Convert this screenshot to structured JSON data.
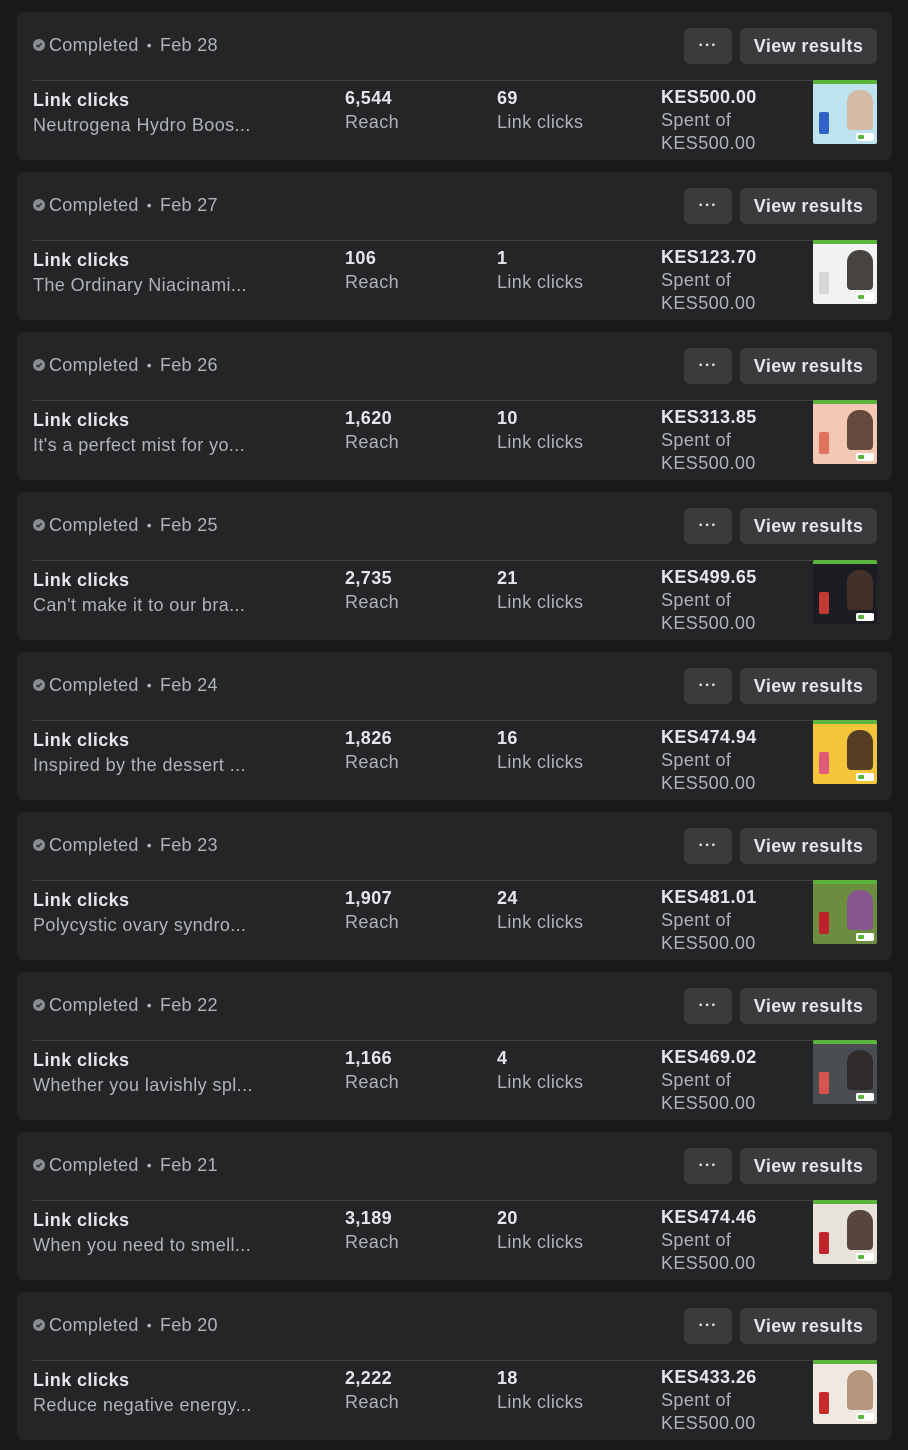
{
  "campaigns": [
    {
      "status": "Completed",
      "date": "Feb 28",
      "more_label": "···",
      "view_label": "View results",
      "objective": "Link clicks",
      "ad_text": "Neutrogena Hydro Boos...",
      "reach_value": "6,544",
      "reach_label": "Reach",
      "clicks_value": "69",
      "clicks_label": "Link clicks",
      "spent_value": "KES500.00",
      "spent_label": "Spent of",
      "budget_value": "KES500.00",
      "thumb_bg": "#bfe3ee",
      "thumb_fig": "#d8b49a",
      "thumb_prod": "#2f63c7"
    },
    {
      "status": "Completed",
      "date": "Feb 27",
      "more_label": "···",
      "view_label": "View results",
      "objective": "Link clicks",
      "ad_text": "The Ordinary Niacinami...",
      "reach_value": "106",
      "reach_label": "Reach",
      "clicks_value": "1",
      "clicks_label": "Link clicks",
      "spent_value": "KES123.70",
      "spent_label": "Spent of",
      "budget_value": "KES500.00",
      "thumb_bg": "#f2f2f2",
      "thumb_fig": "#2a2322",
      "thumb_prod": "#d8d8d8"
    },
    {
      "status": "Completed",
      "date": "Feb 26",
      "more_label": "···",
      "view_label": "View results",
      "objective": "Link clicks",
      "ad_text": "It's a perfect mist for yo...",
      "reach_value": "1,620",
      "reach_label": "Reach",
      "clicks_value": "10",
      "clicks_label": "Link clicks",
      "spent_value": "KES313.85",
      "spent_label": "Spent of",
      "budget_value": "KES500.00",
      "thumb_bg": "#f3c9b6",
      "thumb_fig": "#4b3328",
      "thumb_prod": "#e2735f"
    },
    {
      "status": "Completed",
      "date": "Feb 25",
      "more_label": "···",
      "view_label": "View results",
      "objective": "Link clicks",
      "ad_text": "Can't make it to our bra...",
      "reach_value": "2,735",
      "reach_label": "Reach",
      "clicks_value": "21",
      "clicks_label": "Link clicks",
      "spent_value": "KES499.65",
      "spent_label": "Spent of",
      "budget_value": "KES500.00",
      "thumb_bg": "#1c1d22",
      "thumb_fig": "#4a342a",
      "thumb_prod": "#c23a31"
    },
    {
      "status": "Completed",
      "date": "Feb 24",
      "more_label": "···",
      "view_label": "View results",
      "objective": "Link clicks",
      "ad_text": "Inspired by the dessert ...",
      "reach_value": "1,826",
      "reach_label": "Reach",
      "clicks_value": "16",
      "clicks_label": "Link clicks",
      "spent_value": "KES474.94",
      "spent_label": "Spent of",
      "budget_value": "KES500.00",
      "thumb_bg": "#f2c53b",
      "thumb_fig": "#3a2620",
      "thumb_prod": "#e25a7a"
    },
    {
      "status": "Completed",
      "date": "Feb 23",
      "more_label": "···",
      "view_label": "View results",
      "objective": "Link clicks",
      "ad_text": "Polycystic ovary syndro...",
      "reach_value": "1,907",
      "reach_label": "Reach",
      "clicks_value": "24",
      "clicks_label": "Link clicks",
      "spent_value": "KES481.01",
      "spent_label": "Spent of",
      "budget_value": "KES500.00",
      "thumb_bg": "#6c8d3f",
      "thumb_fig": "#8a4c9c",
      "thumb_prod": "#c1202a"
    },
    {
      "status": "Completed",
      "date": "Feb 22",
      "more_label": "···",
      "view_label": "View results",
      "objective": "Link clicks",
      "ad_text": "Whether you lavishly spl...",
      "reach_value": "1,166",
      "reach_label": "Reach",
      "clicks_value": "4",
      "clicks_label": "Link clicks",
      "spent_value": "KES469.02",
      "spent_label": "Spent of",
      "budget_value": "KES500.00",
      "thumb_bg": "#4a4e52",
      "thumb_fig": "#2a2624",
      "thumb_prod": "#d9534f"
    },
    {
      "status": "Completed",
      "date": "Feb 21",
      "more_label": "···",
      "view_label": "View results",
      "objective": "Link clicks",
      "ad_text": "When you need to smell...",
      "reach_value": "3,189",
      "reach_label": "Reach",
      "clicks_value": "20",
      "clicks_label": "Link clicks",
      "spent_value": "KES474.46",
      "spent_label": "Spent of",
      "budget_value": "KES500.00",
      "thumb_bg": "#e8e3da",
      "thumb_fig": "#3d2a22",
      "thumb_prod": "#c0272d"
    },
    {
      "status": "Completed",
      "date": "Feb 20",
      "more_label": "···",
      "view_label": "View results",
      "objective": "Link clicks",
      "ad_text": "Reduce negative energy...",
      "reach_value": "2,222",
      "reach_label": "Reach",
      "clicks_value": "18",
      "clicks_label": "Link clicks",
      "spent_value": "KES433.26",
      "spent_label": "Spent of",
      "budget_value": "KES500.00",
      "thumb_bg": "#efe9e2",
      "thumb_fig": "#a9866b",
      "thumb_prod": "#c62b2b"
    }
  ]
}
